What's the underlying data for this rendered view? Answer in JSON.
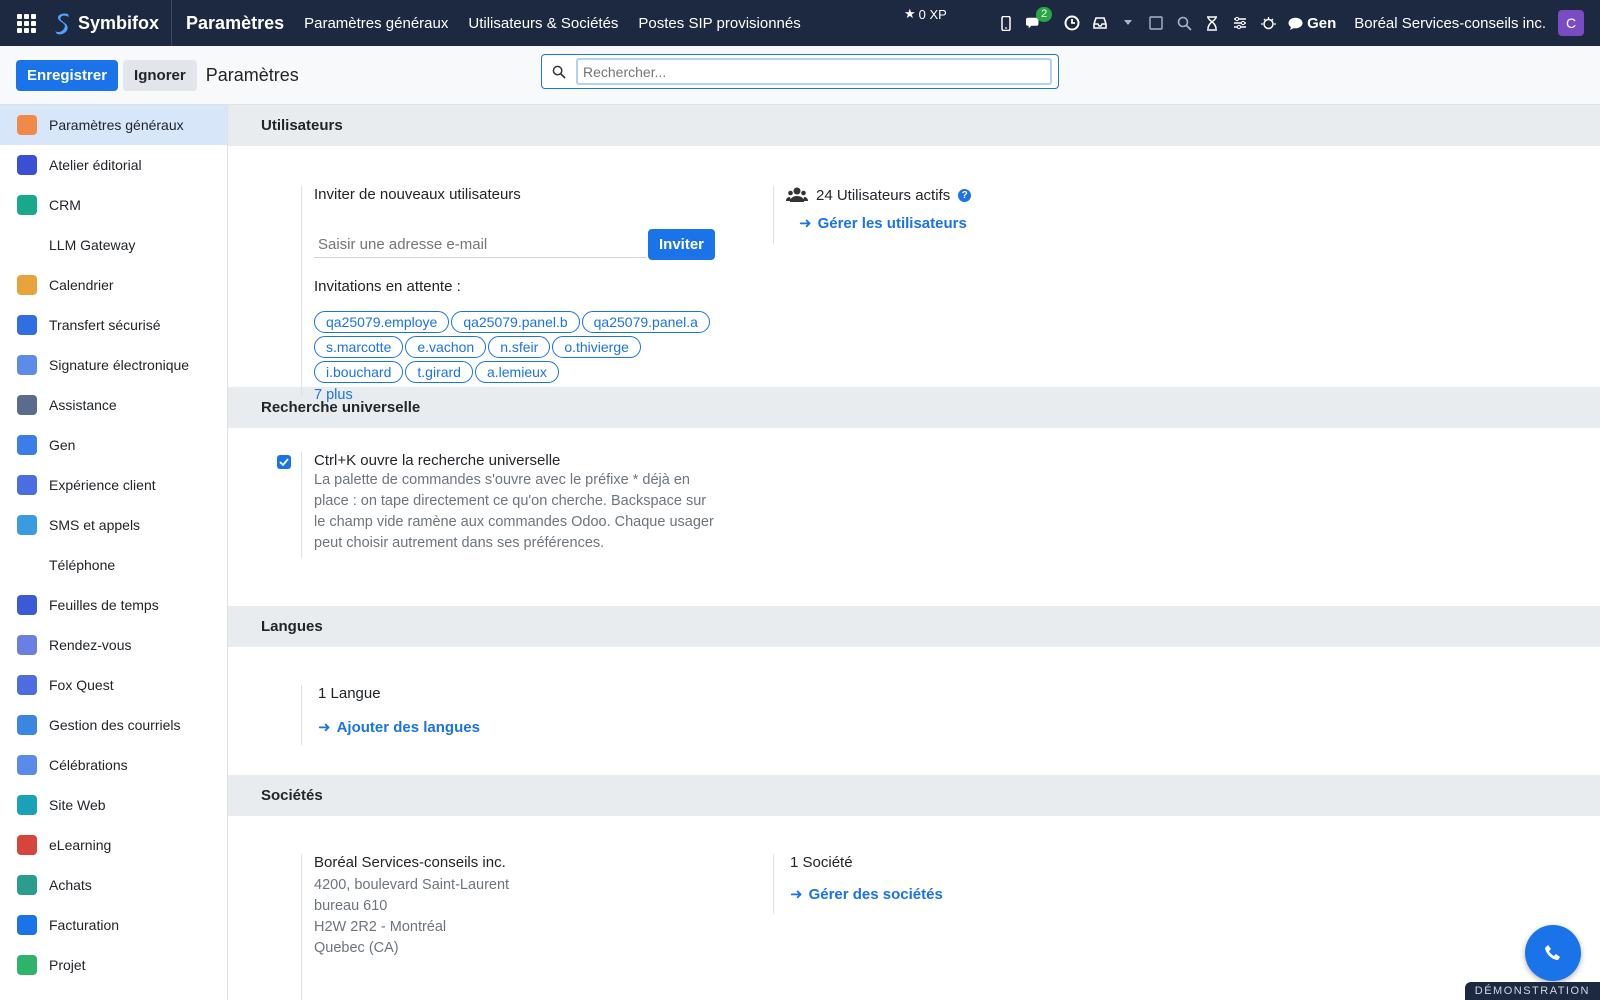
{
  "navbar": {
    "brand": "Symbifox",
    "title": "Paramètres",
    "menu": [
      "Paramètres généraux",
      "Utilisateurs & Sociétés",
      "Postes SIP provisionnés"
    ],
    "xp": "0 XP",
    "messages_badge": "2",
    "gen_label": "Gen",
    "company": "Boréal Services-conseils inc.",
    "avatar_letter": "C"
  },
  "control_panel": {
    "save_label": "Enregistrer",
    "discard_label": "Ignorer",
    "title": "Paramètres",
    "search_placeholder": "Rechercher..."
  },
  "sidebar": {
    "items": [
      {
        "label": "Paramètres généraux",
        "icon": "settings-app-icon",
        "color": "#f08a4b",
        "active": true
      },
      {
        "label": "Atelier éditorial",
        "icon": "editorial-icon",
        "color": "#3b4fd6"
      },
      {
        "label": "CRM",
        "icon": "crm-icon",
        "color": "#1aa88c"
      },
      {
        "label": "LLM Gateway",
        "icon": "",
        "color": ""
      },
      {
        "label": "Calendrier",
        "icon": "calendar-icon",
        "color": "#e8a33d"
      },
      {
        "label": "Transfert sécurisé",
        "icon": "transfer-icon",
        "color": "#2f6fe0"
      },
      {
        "label": "Signature électronique",
        "icon": "signature-icon",
        "color": "#5d8be8"
      },
      {
        "label": "Assistance",
        "icon": "lifebuoy-icon",
        "color": "#5a6b8c"
      },
      {
        "label": "Gen",
        "icon": "gen-icon",
        "color": "#3b7ee8"
      },
      {
        "label": "Expérience client",
        "icon": "customer-icon",
        "color": "#4a6ee0"
      },
      {
        "label": "SMS et appels",
        "icon": "sms-icon",
        "color": "#3a9be0"
      },
      {
        "label": "Téléphone",
        "icon": "",
        "color": ""
      },
      {
        "label": "Feuilles de temps",
        "icon": "timesheet-icon",
        "color": "#3b5bd6"
      },
      {
        "label": "Rendez-vous",
        "icon": "appointment-icon",
        "color": "#6a7fe0"
      },
      {
        "label": "Fox Quest",
        "icon": "fox-quest-icon",
        "color": "#4f6be0"
      },
      {
        "label": "Gestion des courriels",
        "icon": "email-icon",
        "color": "#3a86e0"
      },
      {
        "label": "Célébrations",
        "icon": "cake-icon",
        "color": "#5b8be8"
      },
      {
        "label": "Site Web",
        "icon": "website-icon",
        "color": "#1aa0b8"
      },
      {
        "label": "eLearning",
        "icon": "elearning-icon",
        "color": "#d6453b"
      },
      {
        "label": "Achats",
        "icon": "purchase-icon",
        "color": "#2a9d8f"
      },
      {
        "label": "Facturation",
        "icon": "invoice-icon",
        "color": "#1a73e8"
      },
      {
        "label": "Projet",
        "icon": "project-icon",
        "color": "#2fb36a"
      }
    ]
  },
  "users_section": {
    "header": "Utilisateurs",
    "invite_title": "Inviter de nouveaux utilisateurs",
    "email_placeholder": "Saisir une adresse e-mail",
    "invite_button": "Inviter",
    "pending_label": "Invitations en attente :",
    "pending": [
      "qa25079.employe",
      "qa25079.panel.b",
      "qa25079.panel.a",
      "s.marcotte",
      "e.vachon",
      "n.sfeir",
      "o.thivierge",
      "i.bouchard",
      "t.girard",
      "a.lemieux"
    ],
    "more_label": "7 plus",
    "active_users": "24 Utilisateurs actifs",
    "manage_users": "Gérer les utilisateurs"
  },
  "search_section": {
    "header": "Recherche universelle",
    "checkbox_label": "Ctrl+K ouvre la recherche universelle",
    "checked": true,
    "description": "La palette de commandes s'ouvre avec le préfixe * déjà en place : on tape directement ce qu'on cherche. Backspace sur le champ vide ramène aux commandes Odoo. Chaque usager peut choisir autrement dans ses préférences."
  },
  "languages_section": {
    "header": "Langues",
    "count": "1 Langue",
    "add_link": "Ajouter des langues"
  },
  "companies_section": {
    "header": "Sociétés",
    "company_name": "Boréal Services-conseils inc.",
    "address_lines": [
      "4200, boulevard Saint-Laurent",
      "bureau 610",
      "H2W 2R2 - Montréal",
      "Quebec (CA)"
    ],
    "count": "1 Société",
    "manage_link": "Gérer des sociétés"
  },
  "demo_label": "DÉMONSTRATION"
}
